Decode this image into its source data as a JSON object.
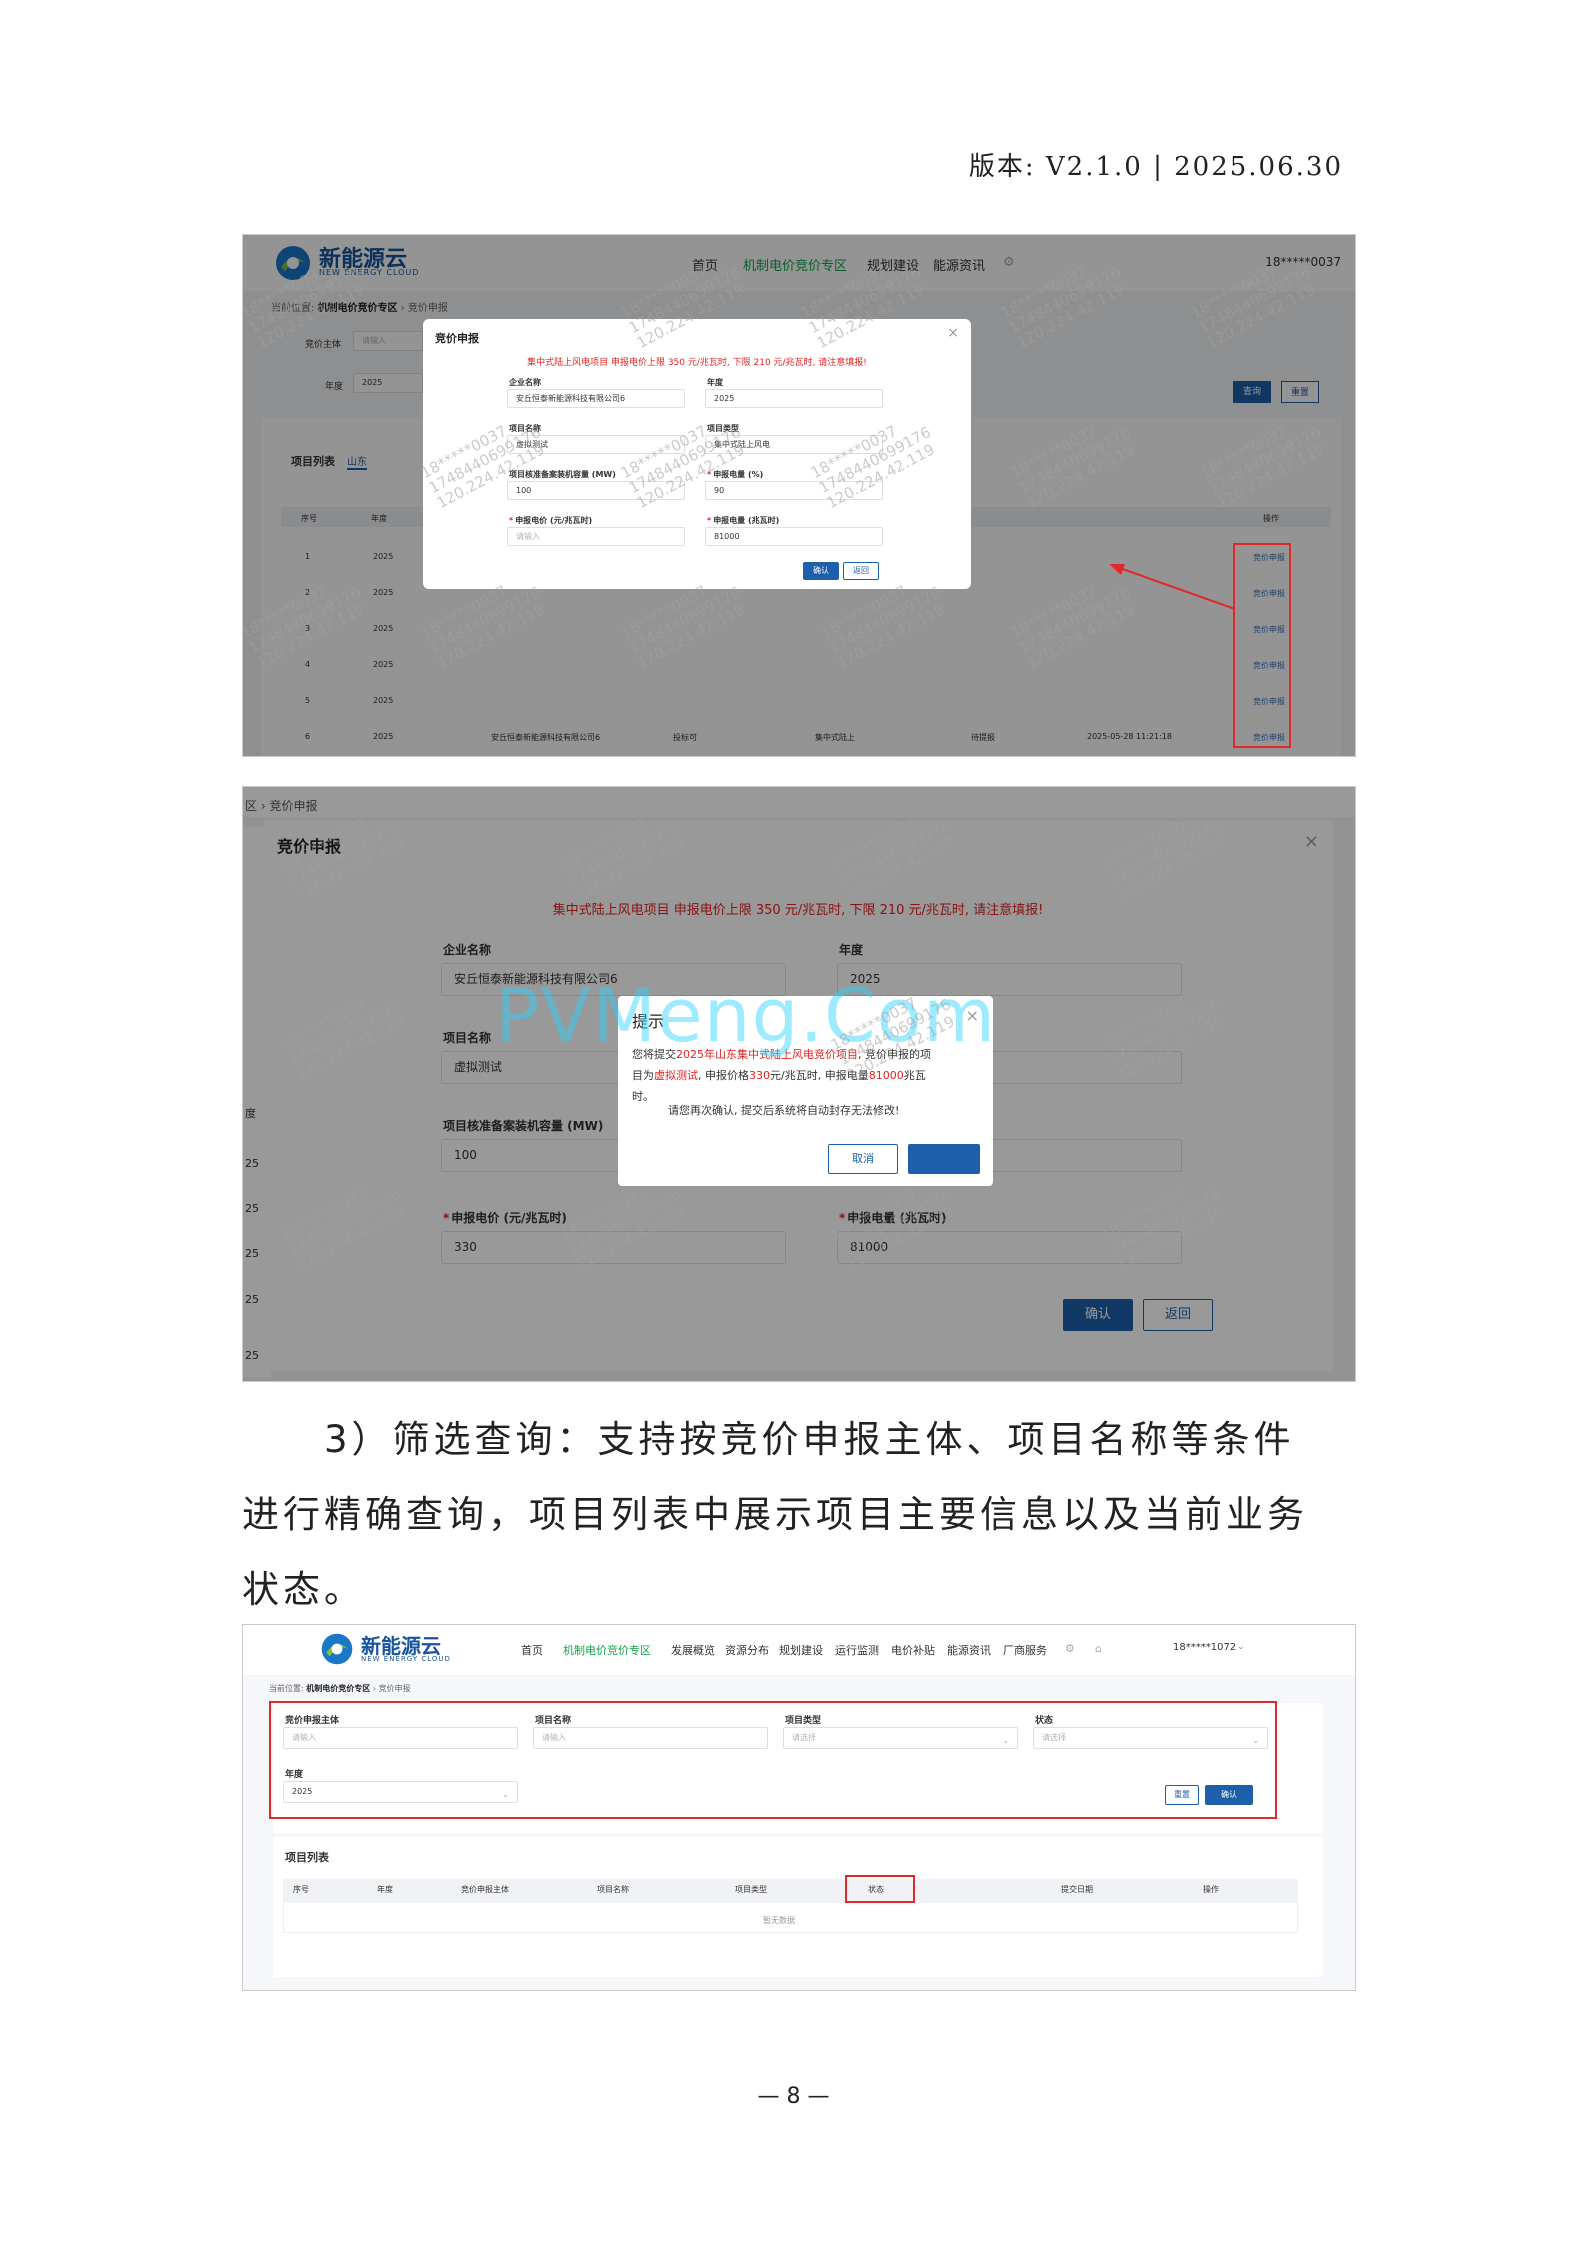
{
  "header": {
    "version": "版本: V2.1.0 | 2025.06.30"
  },
  "common": {
    "logo_cn": "新能源云",
    "logo_en": "NEW ENERGY CLOUD",
    "watermark_line1": "18*****0037",
    "watermark_line2": "1748440699176",
    "watermark_line3": "120.224.42.119",
    "pvmeng": "PVMeng.Com"
  },
  "shot1": {
    "nav": [
      "首页",
      "机制电价竞价专区",
      "规划建设",
      "能源资讯"
    ],
    "user": "18*****0037",
    "crumb_prefix": "当前位置:",
    "crumb_mid": "机制电价竞价专区",
    "crumb_end": "竞价申报",
    "bg_label_entity": "竞价主体",
    "bg_placeholder": "请输入",
    "bg_label_year": "年度",
    "bg_year": "2025",
    "bg_query": "查询",
    "bg_reset": "重置",
    "bg_list_title": "项目列表",
    "bg_tab": "山东",
    "bg_col_no": "序号",
    "bg_col_year": "年度",
    "bg_col_op": "操作",
    "bg_rows": [
      "1",
      "2",
      "3",
      "4",
      "5",
      "6"
    ],
    "bg_row_year": "2025",
    "bg_row6_company": "安丘恒泰新能源科技有限公司6",
    "bg_row6_name": "投标可",
    "bg_row6_type": "集中式陆上",
    "bg_row6_status": "待提报",
    "bg_row6_time": "2025-05-28 11:21:18",
    "op_link": "竞价申报",
    "modal": {
      "title": "竞价申报",
      "close": "×",
      "warning": "集中式陆上风电项目 申报电价上限 350 元/兆瓦时, 下限 210 元/兆瓦时, 请注意填报!",
      "company_label": "企业名称",
      "company_value": "安丘恒泰新能源科技有限公司6",
      "year_label": "年度",
      "year_value": "2025",
      "pname_label": "项目名称",
      "pname_value": "虚拟测试",
      "ptype_label": "项目类型",
      "ptype_value": "集中式陆上风电",
      "cap_label": "项目核准备案装机容量 (MW)",
      "cap_value": "100",
      "ratio_label": "申报电量 (%)",
      "ratio_value": "90",
      "price_label": "申报电价 (元/兆瓦时)",
      "price_placeholder": "请输入",
      "energy_label": "申报电量 (兆瓦时)",
      "energy_value": "81000",
      "confirm": "确认",
      "back": "返回",
      "asterisk": "*"
    }
  },
  "shot2": {
    "crumb_prefix": "区",
    "crumb_end": "竞价申报",
    "title": "竞价申报",
    "close": "×",
    "warning": "集中式陆上风电项目 申报电价上限 350 元/兆瓦时, 下限 210 元/兆瓦时, 请注意填报!",
    "company_label": "企业名称",
    "company_value": "安丘恒泰新能源科技有限公司6",
    "year_label": "年度",
    "year_value": "2025",
    "pname_label": "项目名称",
    "pname_value": "虚拟测试",
    "cap_label": "项目核准备案装机容量 (MW)",
    "cap_value": "100",
    "price_label": "申报电价 (元/兆瓦时)",
    "price_value": "330",
    "energy_label": "申报电量 (兆瓦时)",
    "energy_value": "81000",
    "confirm": "确认",
    "back": "返回",
    "asterisk": "*",
    "side_labels": [
      "度",
      "25",
      "25",
      "25",
      "25",
      "25"
    ],
    "dialog": {
      "title": "提示",
      "close": "×",
      "l1a": "您将提交",
      "l1b": "2025年山东集中式陆上风电竞价项目",
      "l1c": ", 竞价申报的项",
      "l2a": "目为",
      "l2b": "虚拟测试",
      "l2c": ", 申报价格",
      "l2d": "330",
      "l2e": "元/兆瓦时, 申报电量",
      "l2f": "81000",
      "l2g": "兆瓦",
      "l3": "时。",
      "confirm_line": "请您再次确认, 提交后系统将自动封存无法修改!",
      "cancel": "取消"
    }
  },
  "para": {
    "line1": "3）筛选查询：支持按竞价申报主体、项目名称等条件",
    "line2": "进行精确查询，项目列表中展示项目主要信息以及当前业务",
    "line3": "状态。"
  },
  "shot3": {
    "nav": [
      "首页",
      "机制电价竞价专区",
      "发展概览",
      "资源分布",
      "规划建设",
      "运行监测",
      "电价补贴",
      "能源资讯",
      "厂商服务"
    ],
    "user": "18*****1072",
    "crumb_prefix": "当前位置:",
    "crumb_mid": "机制电价竞价专区",
    "crumb_end": "竞价申报",
    "f_entity": "竞价申报主体",
    "f_name": "项目名称",
    "f_type": "项目类型",
    "f_status": "状态",
    "f_year": "年度",
    "ph_input": "请输入",
    "ph_select": "请选择",
    "year_value": "2025",
    "reset": "重置",
    "confirm": "确认",
    "list_title": "项目列表",
    "cols": [
      "序号",
      "年度",
      "竞价申报主体",
      "项目名称",
      "项目类型",
      "状态",
      "提交日期",
      "操作"
    ],
    "empty": "暂无数据"
  },
  "footer": {
    "page": "— 8 —"
  }
}
